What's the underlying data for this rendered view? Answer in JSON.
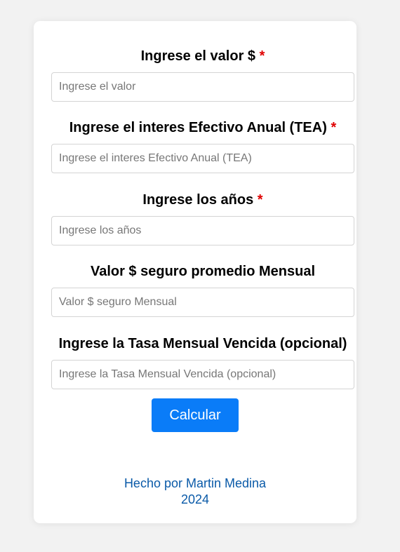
{
  "form": {
    "fields": [
      {
        "label": "Ingrese el valor $",
        "required_mark": "*",
        "placeholder": "Ingrese el valor"
      },
      {
        "label": "Ingrese el interes Efectivo Anual (TEA)",
        "required_mark": "*",
        "placeholder": "Ingrese el interes Efectivo Anual (TEA)"
      },
      {
        "label": "Ingrese los años",
        "required_mark": "*",
        "placeholder": "Ingrese los años"
      },
      {
        "label": "Valor $ seguro promedio Mensual",
        "placeholder": "Valor $ seguro Mensual"
      },
      {
        "label": "Ingrese la Tasa Mensual Vencida (opcional)",
        "placeholder": "Ingrese la Tasa Mensual Vencida (opcional)"
      }
    ],
    "submit_label": "Calcular"
  },
  "footer": {
    "credit": "Hecho por Martin Medina",
    "year": "2024"
  },
  "colors": {
    "background": "#f2f2f2",
    "card": "#ffffff",
    "button": "#0a7cf8",
    "required_mark": "#e00000",
    "footer_text": "#0a5aa8"
  }
}
